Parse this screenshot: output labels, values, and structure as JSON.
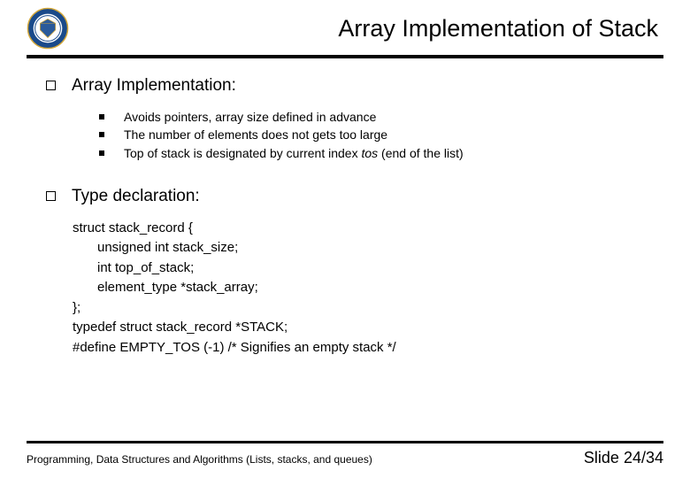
{
  "header": {
    "title": "Array Implementation of Stack"
  },
  "sections": {
    "s1": {
      "heading": "Array Implementation:",
      "bullets": [
        "Avoids pointers, array size defined in advance",
        "The number of elements does not gets too large",
        "Top of stack is designated by current index "
      ],
      "bullet3_ital": "tos",
      "bullet3_rest": " (end of the list)"
    },
    "s2": {
      "heading": "Type declaration:",
      "code": {
        "l1": "struct stack_record {",
        "l2": "unsigned int stack_size;",
        "l3": "int top_of_stack;",
        "l4": "element_type *stack_array;",
        "l5": "};",
        "l6": "typedef struct stack_record *STACK;",
        "l7": "#define EMPTY_TOS (-1)  /* Signifies an empty stack */"
      }
    }
  },
  "footer": {
    "left": "Programming, Data Structures and Algorithms  (Lists, stacks, and queues)",
    "right": "Slide 24/34"
  }
}
